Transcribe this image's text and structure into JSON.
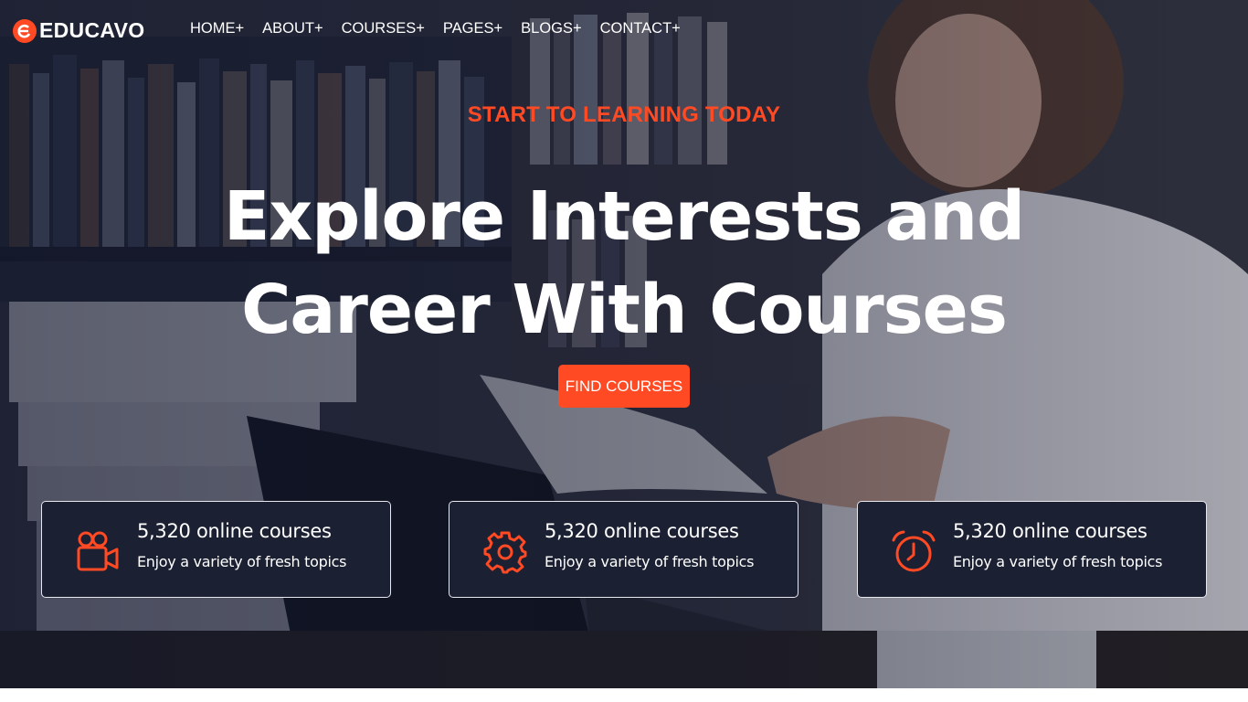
{
  "brand": {
    "name": "EDUCAVO"
  },
  "nav": {
    "items": [
      {
        "label": "HOME+"
      },
      {
        "label": "ABOUT+"
      },
      {
        "label": "COURSES+"
      },
      {
        "label": "PAGES+"
      },
      {
        "label": "BLOGS+"
      },
      {
        "label": "CONTACT+"
      }
    ]
  },
  "hero": {
    "eyebrow": "START TO LEARNING TODAY",
    "headline_line1": "Explore Interests and",
    "headline_line2": "Career With Courses",
    "cta_label": "FIND COURSES"
  },
  "features": [
    {
      "icon": "video-camera-icon",
      "title": "5,320 online courses",
      "subtitle": "Enjoy a variety of fresh topics"
    },
    {
      "icon": "gear-icon",
      "title": "5,320 online courses",
      "subtitle": "Enjoy a variety of fresh topics"
    },
    {
      "icon": "alarm-clock-icon",
      "title": "5,320 online courses",
      "subtitle": "Enjoy a variety of fresh topics"
    }
  ],
  "colors": {
    "accent": "#ff4a24",
    "card_bg": "#1b2033",
    "overlay": "#0e142c"
  }
}
